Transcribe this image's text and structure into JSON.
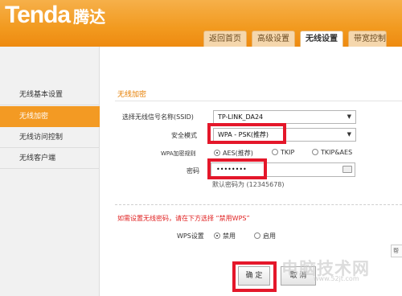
{
  "brand": {
    "logo_text": "Tenda",
    "logo_cn": "腾达"
  },
  "tabs": [
    "返回首页",
    "高级设置",
    "无线设置",
    "带宽控制"
  ],
  "sidebar": {
    "items": [
      {
        "label": "无线基本设置"
      },
      {
        "label": "无线加密"
      },
      {
        "label": "无线访问控制"
      },
      {
        "label": "无线客户端"
      }
    ]
  },
  "form": {
    "section_title": "无线加密",
    "ssid_label": "选择无线信号名称(SSID)",
    "ssid_value": "TP-LINK_DA24",
    "security_label": "安全模式",
    "security_value": "WPA - PSK(推荐)",
    "cipher_label": "WPA加密规则",
    "cipher_options": [
      "AES(推荐)",
      "TKIP",
      "TKIP&AES"
    ],
    "password_label": "密码",
    "password_value": "••••••••",
    "default_hint": "默认密码为 (12345678)"
  },
  "wps": {
    "warning": "如需设置无线密码，请在下方选择 “禁用WPS”",
    "label": "WPS设置",
    "options": [
      "禁用",
      "启用"
    ],
    "help_label": "帮"
  },
  "buttons": {
    "ok": "确 定",
    "cancel": "取 消"
  },
  "watermark": {
    "text": "电脑技术网",
    "url": "www.52jt.com"
  },
  "colors": {
    "header": "#f29a1f",
    "accent": "#f39a23",
    "highlight_box": "#e4172a",
    "warning": "#e02020"
  }
}
